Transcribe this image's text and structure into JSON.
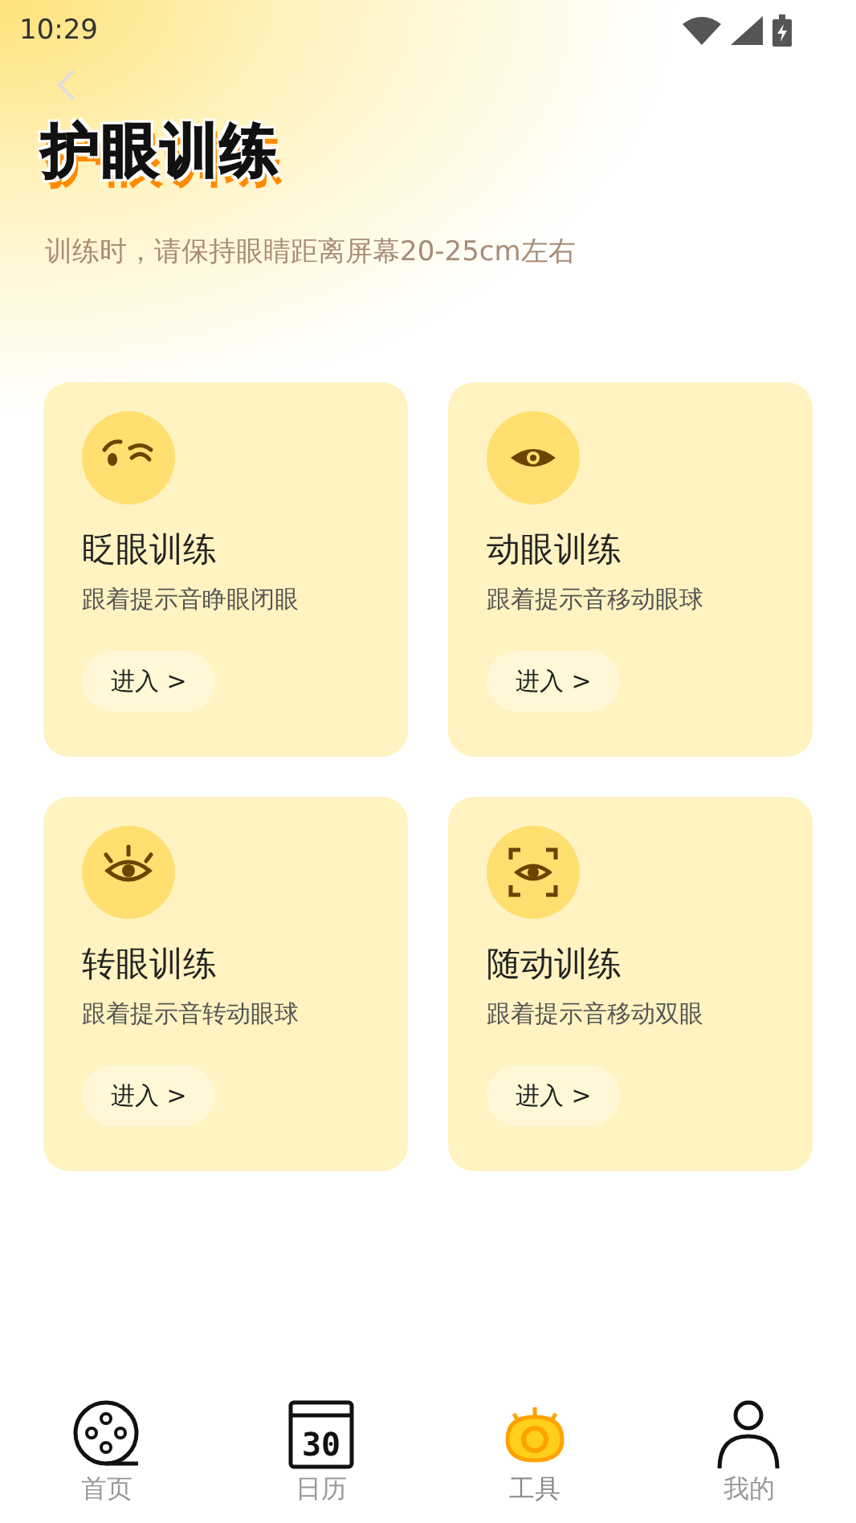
{
  "status_bar": {
    "time": "10:29"
  },
  "header": {
    "title": "护眼训练",
    "subtitle": "训练时，请保持眼睛距离屏幕20-25cm左右"
  },
  "cards": [
    {
      "kind": "blink",
      "title": "眨眼训练",
      "description": "跟着提示音睁眼闭眼",
      "button": "进入 >"
    },
    {
      "kind": "move",
      "title": "动眼训练",
      "description": "跟着提示音移动眼球",
      "button": "进入 >"
    },
    {
      "kind": "rotate",
      "title": "转眼训练",
      "description": "跟着提示音转动眼球",
      "button": "进入 >"
    },
    {
      "kind": "follow",
      "title": "随动训练",
      "description": "跟着提示音移动双眼",
      "button": "进入 >"
    }
  ],
  "tab_bar": [
    {
      "kind": "home",
      "label": "首页",
      "selected": false
    },
    {
      "kind": "calendar",
      "label": "日历",
      "icon_text": "30",
      "selected": false
    },
    {
      "kind": "tools",
      "label": "工具",
      "selected": true
    },
    {
      "kind": "profile",
      "label": "我的",
      "selected": false
    }
  ]
}
